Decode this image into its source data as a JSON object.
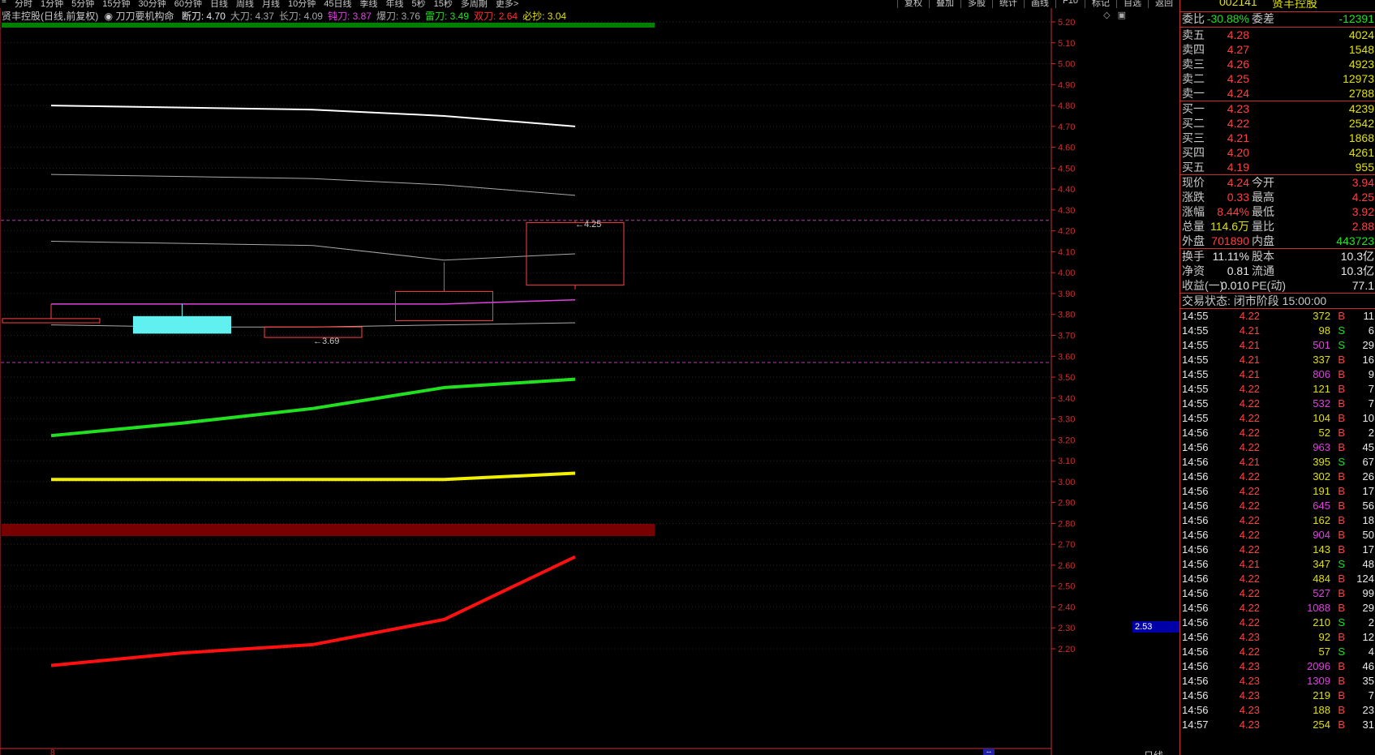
{
  "topbar": {
    "periods": [
      "分时",
      "1分钟",
      "5分钟",
      "15分钟",
      "30分钟",
      "60分钟",
      "日线",
      "周线",
      "月线",
      "10分钟",
      "45日线",
      "季线",
      "年线",
      "5秒",
      "15秒",
      "多周期",
      "更多>"
    ],
    "tools": [
      "复权",
      "叠加",
      "多股",
      "统计",
      "画线",
      "F10",
      "标记",
      "自选",
      "返回"
    ]
  },
  "info": {
    "stock": "贤丰控股(日线,前复权)",
    "indicator": "刀刀要机构命",
    "labels": [
      {
        "text": "断刀: 4.70",
        "color": "#e8e8e8"
      },
      {
        "text": "大刀: 4.37",
        "color": "#a8a8a8"
      },
      {
        "text": "长刀: 4.09",
        "color": "#a8a8a8"
      },
      {
        "text": "钝刀: 3.87",
        "color": "#e040e0"
      },
      {
        "text": "爆刀: 3.76",
        "color": "#a8a8a8"
      },
      {
        "text": "雷刀: 3.49",
        "color": "#20e020"
      },
      {
        "text": "双刀: 2.64",
        "color": "#ff3030"
      },
      {
        "text": "必抄: 3.04",
        "color": "#e0e000"
      }
    ]
  },
  "axis": {
    "ticks": [
      5.2,
      5.1,
      5.0,
      4.9,
      4.8,
      4.7,
      4.6,
      4.5,
      4.4,
      4.3,
      4.2,
      4.1,
      4.0,
      3.9,
      3.8,
      3.7,
      3.6,
      3.5,
      3.4,
      3.3,
      3.2,
      3.1,
      3.0,
      2.9,
      2.8,
      2.7,
      2.6,
      2.5,
      2.4,
      2.3,
      2.2
    ],
    "current_price": "2.53",
    "bottom_period": "日线",
    "scroll_marker": "--",
    "bottom_left": "8"
  },
  "chart_data": {
    "type": "candlestick",
    "candles": [
      {
        "open": 3.78,
        "close": 3.76,
        "high": 3.85,
        "low": 3.76,
        "color": "#ff4040",
        "filled": false
      },
      {
        "open": 3.79,
        "close": 3.71,
        "high": 3.85,
        "low": 3.71,
        "color": "#60f0f0",
        "filled": true
      },
      {
        "open": 3.69,
        "close": 3.74,
        "high": 3.74,
        "low": 3.69,
        "color": "#ff4040",
        "filled": false
      },
      {
        "open": 3.77,
        "close": 3.91,
        "high": 4.05,
        "low": 3.77,
        "color": "#ff4040",
        "filled": false
      },
      {
        "open": 3.94,
        "close": 4.24,
        "high": 4.25,
        "low": 3.92,
        "color": "#ff4040",
        "filled": false
      }
    ],
    "annotations": [
      {
        "text": "←3.69",
        "price": 3.69,
        "candle": 2
      },
      {
        "text": "←4.25",
        "price": 4.25,
        "candle": 4
      }
    ],
    "series": [
      {
        "name": "断刀",
        "color": "#ffffff",
        "width": 2,
        "values": [
          4.8,
          4.79,
          4.78,
          4.75,
          4.7
        ]
      },
      {
        "name": "大刀",
        "color": "#a8a8a8",
        "width": 1,
        "values": [
          4.47,
          4.46,
          4.45,
          4.42,
          4.37
        ]
      },
      {
        "name": "长刀",
        "color": "#a8a8a8",
        "width": 1,
        "values": [
          4.15,
          4.14,
          4.13,
          4.06,
          4.09
        ]
      },
      {
        "name": "钝刀",
        "color": "#e040e0",
        "width": 1.5,
        "values": [
          3.85,
          3.85,
          3.85,
          3.85,
          3.87
        ]
      },
      {
        "name": "爆刀",
        "color": "#a8a8a8",
        "width": 1,
        "values": [
          3.75,
          3.74,
          3.74,
          3.75,
          3.76
        ]
      },
      {
        "name": "雷刀",
        "color": "#20e020",
        "width": 4,
        "values": [
          3.22,
          3.28,
          3.35,
          3.45,
          3.49
        ]
      },
      {
        "name": "必抄",
        "color": "#f0f000",
        "width": 4,
        "values": [
          3.01,
          3.01,
          3.01,
          3.01,
          3.04
        ]
      },
      {
        "name": "双刀",
        "color": "#ff1010",
        "width": 4,
        "values": [
          2.12,
          2.18,
          2.22,
          2.34,
          2.64
        ]
      }
    ],
    "hlines": [
      4.25,
      3.57
    ],
    "ylim": [
      2.1,
      5.23
    ]
  },
  "panel": {
    "code": "002141",
    "name": "贤丰控股",
    "weibi": {
      "label": "委比",
      "value": "-30.88%",
      "label2": "委差",
      "value2": "-12391"
    },
    "sells": [
      {
        "label": "卖五",
        "price": "4.28",
        "vol": "4024"
      },
      {
        "label": "卖四",
        "price": "4.27",
        "vol": "1548"
      },
      {
        "label": "卖三",
        "price": "4.26",
        "vol": "4923"
      },
      {
        "label": "卖二",
        "price": "4.25",
        "vol": "12973"
      },
      {
        "label": "卖一",
        "price": "4.24",
        "vol": "2788"
      }
    ],
    "buys": [
      {
        "label": "买一",
        "price": "4.23",
        "vol": "4239"
      },
      {
        "label": "买二",
        "price": "4.22",
        "vol": "2542"
      },
      {
        "label": "买三",
        "price": "4.21",
        "vol": "1868"
      },
      {
        "label": "买四",
        "price": "4.20",
        "vol": "4261"
      },
      {
        "label": "买五",
        "price": "4.19",
        "vol": "955"
      }
    ],
    "quote": [
      {
        "l1": "现价",
        "v1": "4.24",
        "c1": "red",
        "l2": "今开",
        "v2": "3.94",
        "c2": "red"
      },
      {
        "l1": "涨跌",
        "v1": "0.33",
        "c1": "red",
        "l2": "最高",
        "v2": "4.25",
        "c2": "red"
      },
      {
        "l1": "涨幅",
        "v1": "8.44%",
        "c1": "red",
        "l2": "最低",
        "v2": "3.92",
        "c2": "red"
      },
      {
        "l1": "总量",
        "v1": "114.6万",
        "c1": "yellow",
        "l2": "量比",
        "v2": "2.88",
        "c2": "red"
      },
      {
        "l1": "外盘",
        "v1": "701890",
        "c1": "red",
        "l2": "内盘",
        "v2": "443723",
        "c2": "green"
      }
    ],
    "fundamentals": [
      {
        "l1": "换手",
        "v1": "11.11%",
        "l2": "股本",
        "v2": "10.3亿"
      },
      {
        "l1": "净资",
        "v1": "0.81",
        "l2": "流通",
        "v2": "10.3亿"
      },
      {
        "l1": "收益(一)",
        "v1": "0.010",
        "l2": "PE(动)",
        "v2": "77.1"
      }
    ],
    "status": "交易状态: 闭市阶段 15:00:00",
    "ticks": [
      {
        "t": "14:55",
        "p": "4.22",
        "v": "372",
        "vc": "yellow",
        "d": "B",
        "n": "11"
      },
      {
        "t": "14:55",
        "p": "4.21",
        "v": "98",
        "vc": "yellow",
        "d": "S",
        "n": "6"
      },
      {
        "t": "14:55",
        "p": "4.21",
        "v": "501",
        "vc": "magenta",
        "d": "S",
        "n": "29"
      },
      {
        "t": "14:55",
        "p": "4.21",
        "v": "337",
        "vc": "yellow",
        "d": "B",
        "n": "16"
      },
      {
        "t": "14:55",
        "p": "4.21",
        "v": "806",
        "vc": "magenta",
        "d": "B",
        "n": "9"
      },
      {
        "t": "14:55",
        "p": "4.22",
        "v": "121",
        "vc": "yellow",
        "d": "B",
        "n": "7"
      },
      {
        "t": "14:55",
        "p": "4.22",
        "v": "532",
        "vc": "magenta",
        "d": "B",
        "n": "7"
      },
      {
        "t": "14:55",
        "p": "4.22",
        "v": "104",
        "vc": "yellow",
        "d": "B",
        "n": "10"
      },
      {
        "t": "14:56",
        "p": "4.22",
        "v": "52",
        "vc": "yellow",
        "d": "B",
        "n": "2"
      },
      {
        "t": "14:56",
        "p": "4.22",
        "v": "963",
        "vc": "magenta",
        "d": "B",
        "n": "45"
      },
      {
        "t": "14:56",
        "p": "4.21",
        "v": "395",
        "vc": "yellow",
        "d": "S",
        "n": "67"
      },
      {
        "t": "14:56",
        "p": "4.22",
        "v": "302",
        "vc": "yellow",
        "d": "B",
        "n": "26"
      },
      {
        "t": "14:56",
        "p": "4.22",
        "v": "191",
        "vc": "yellow",
        "d": "B",
        "n": "17"
      },
      {
        "t": "14:56",
        "p": "4.22",
        "v": "645",
        "vc": "magenta",
        "d": "B",
        "n": "56"
      },
      {
        "t": "14:56",
        "p": "4.22",
        "v": "162",
        "vc": "yellow",
        "d": "B",
        "n": "18"
      },
      {
        "t": "14:56",
        "p": "4.22",
        "v": "904",
        "vc": "magenta",
        "d": "B",
        "n": "50"
      },
      {
        "t": "14:56",
        "p": "4.22",
        "v": "143",
        "vc": "yellow",
        "d": "B",
        "n": "17"
      },
      {
        "t": "14:56",
        "p": "4.21",
        "v": "347",
        "vc": "yellow",
        "d": "S",
        "n": "48"
      },
      {
        "t": "14:56",
        "p": "4.22",
        "v": "484",
        "vc": "yellow",
        "d": "B",
        "n": "124"
      },
      {
        "t": "14:56",
        "p": "4.22",
        "v": "527",
        "vc": "magenta",
        "d": "B",
        "n": "99"
      },
      {
        "t": "14:56",
        "p": "4.22",
        "v": "1088",
        "vc": "magenta",
        "d": "B",
        "n": "29"
      },
      {
        "t": "14:56",
        "p": "4.22",
        "v": "210",
        "vc": "yellow",
        "d": "S",
        "n": "2"
      },
      {
        "t": "14:56",
        "p": "4.23",
        "v": "92",
        "vc": "yellow",
        "d": "B",
        "n": "12"
      },
      {
        "t": "14:56",
        "p": "4.22",
        "v": "57",
        "vc": "yellow",
        "d": "S",
        "n": "4"
      },
      {
        "t": "14:56",
        "p": "4.23",
        "v": "2096",
        "vc": "magenta",
        "d": "B",
        "n": "46"
      },
      {
        "t": "14:56",
        "p": "4.23",
        "v": "1309",
        "vc": "magenta",
        "d": "B",
        "n": "35"
      },
      {
        "t": "14:56",
        "p": "4.23",
        "v": "219",
        "vc": "yellow",
        "d": "B",
        "n": "7"
      },
      {
        "t": "14:56",
        "p": "4.23",
        "v": "188",
        "vc": "yellow",
        "d": "B",
        "n": "23"
      },
      {
        "t": "14:57",
        "p": "4.23",
        "v": "254",
        "vc": "yellow",
        "d": "B",
        "n": "31"
      }
    ]
  }
}
